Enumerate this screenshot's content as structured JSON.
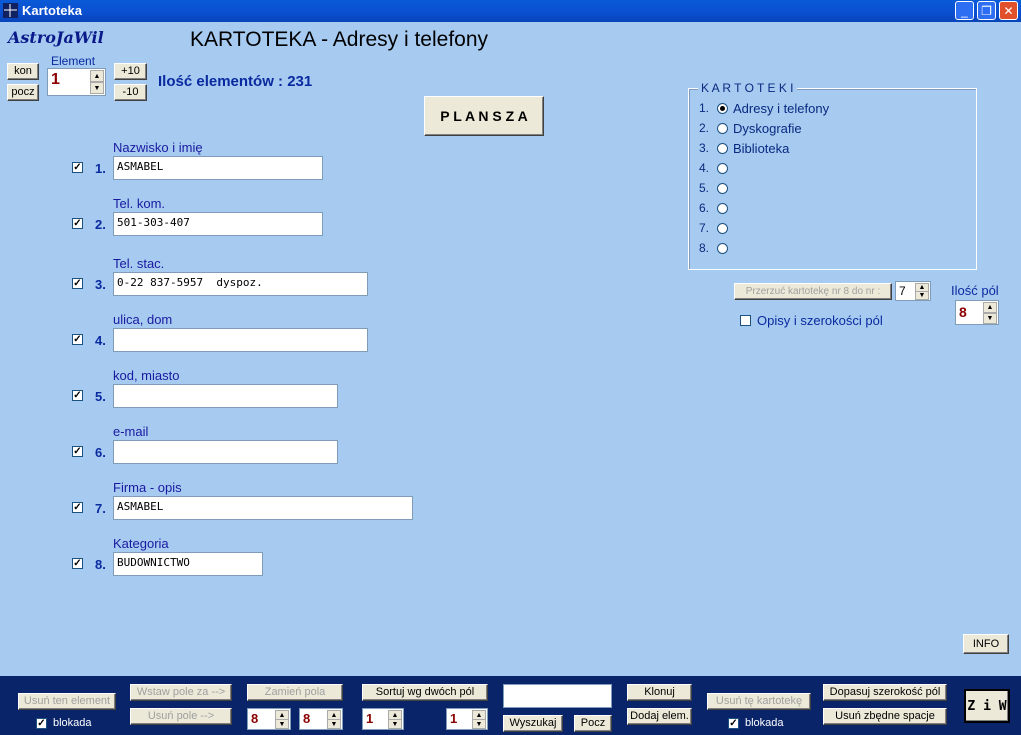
{
  "window": {
    "title": "Kartoteka"
  },
  "header": {
    "logo": "AstroJaWil",
    "title": "KARTOTEKA - Adresy i telefony"
  },
  "nav": {
    "kon": "kon",
    "pocz": "pocz",
    "element_label": "Element",
    "element_value": "1",
    "plus10": "+10",
    "minus10": "-10",
    "count_label": "Ilość elementów : 231"
  },
  "plansza": "P L A N S Z A",
  "fields": [
    {
      "num": "1.",
      "label": "Nazwisko i imię",
      "value": "ASMABEL"
    },
    {
      "num": "2.",
      "label": "Tel. kom.",
      "value": "501-303-407"
    },
    {
      "num": "3.",
      "label": "Tel. stac.",
      "value": "0-22 837-5957  dyspoz."
    },
    {
      "num": "4.",
      "label": "ulica, dom",
      "value": ""
    },
    {
      "num": "5.",
      "label": "kod, miasto",
      "value": ""
    },
    {
      "num": "6.",
      "label": "e-mail",
      "value": ""
    },
    {
      "num": "7.",
      "label": "Firma - opis",
      "value": "ASMABEL"
    },
    {
      "num": "8.",
      "label": "Kategoria",
      "value": "BUDOWNICTWO"
    }
  ],
  "kartoteki": {
    "legend": "K A R T O T E K I",
    "items": [
      {
        "num": "1.",
        "label": "Adresy i telefony",
        "selected": true
      },
      {
        "num": "2.",
        "label": "Dyskografie",
        "selected": false
      },
      {
        "num": "3.",
        "label": "Biblioteka",
        "selected": false
      },
      {
        "num": "4.",
        "label": "",
        "selected": false
      },
      {
        "num": "5.",
        "label": "",
        "selected": false
      },
      {
        "num": "6.",
        "label": "",
        "selected": false
      },
      {
        "num": "7.",
        "label": "",
        "selected": false
      },
      {
        "num": "8.",
        "label": "",
        "selected": false
      }
    ]
  },
  "przerzuc": {
    "label": "Przerzuć kartotekę nr 8 do nr :",
    "value": "7"
  },
  "ilosc_pol": {
    "label": "Ilość pól",
    "value": "8"
  },
  "opisy_label": "Opisy i szerokości pól",
  "info": "INFO",
  "bottom": {
    "usun_element": "Usuń ten element",
    "blokada": "blokada",
    "wstaw_pole": "Wstaw pole za -->",
    "usun_pole": "Usuń pole -->",
    "zamien_pola": "Zamień pola",
    "zamien_a": "8",
    "zamien_b": "8",
    "sortuj": "Sortuj wg dwóch pól",
    "sort_a": "1",
    "sort_b": "1",
    "search_value": "",
    "wyszukaj": "Wyszukaj",
    "pocz": "Pocz",
    "klonuj": "Klonuj",
    "dodaj": "Dodaj elem.",
    "usun_kartoteke": "Usuń tę kartotekę",
    "blokada2": "blokada",
    "dopasuj": "Dopasuj szerokość pól",
    "usun_spacje": "Usuń zbędne spacje",
    "ziw": "Z i W"
  }
}
